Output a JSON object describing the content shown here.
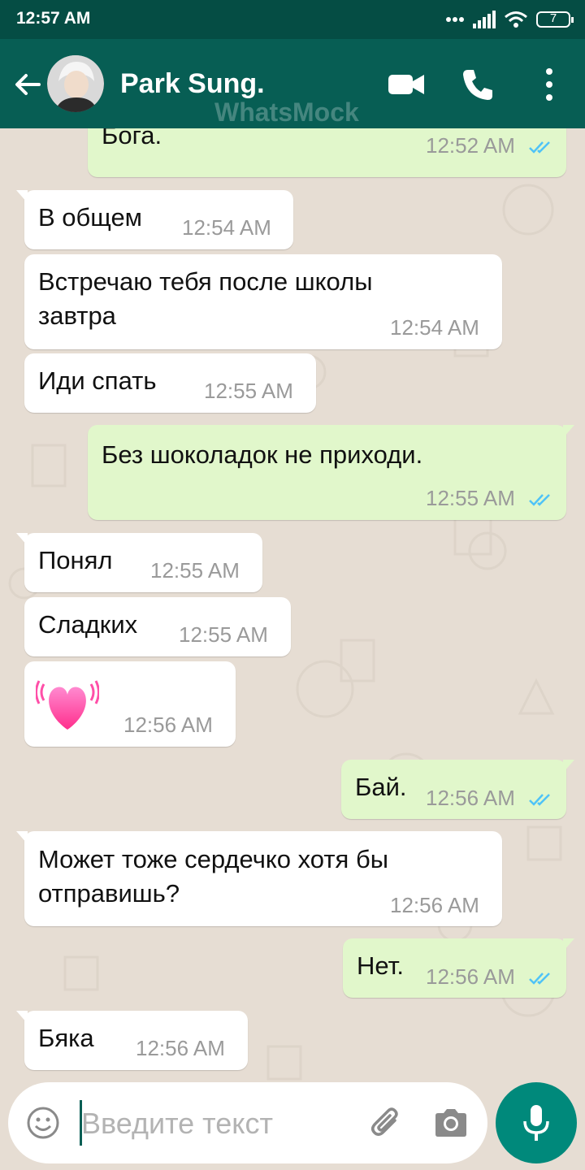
{
  "status_bar": {
    "time": "12:57 AM",
    "battery": "7"
  },
  "header": {
    "contact_name": "Park Sung.",
    "watermark": "WhatsMock"
  },
  "messages": [
    {
      "dir": "out",
      "text": "Бога.",
      "time": "12:52 AM"
    },
    {
      "dir": "in",
      "text": "В общем",
      "time": "12:54 AM"
    },
    {
      "dir": "in",
      "line1": "Встречаю тебя после школы",
      "line2": "завтра",
      "time": "12:54 AM"
    },
    {
      "dir": "in",
      "text": "Иди спать",
      "time": "12:55 AM"
    },
    {
      "dir": "out",
      "text": "Без шоколадок не приходи.",
      "time": "12:55 AM"
    },
    {
      "dir": "in",
      "text": "Понял",
      "time": "12:55 AM"
    },
    {
      "dir": "in",
      "text": "Сладких",
      "time": "12:55 AM"
    },
    {
      "dir": "in",
      "emoji": "heart",
      "time": "12:56 AM"
    },
    {
      "dir": "out",
      "text": "Бай.",
      "time": "12:56 AM"
    },
    {
      "dir": "in",
      "line1": "Может тоже сердечко хотя бы",
      "line2": "отправишь?",
      "time": "12:56 AM"
    },
    {
      "dir": "out",
      "text": "Нет.",
      "time": "12:56 AM"
    },
    {
      "dir": "in",
      "text": "Бяка",
      "time": "12:56 AM"
    }
  ],
  "composer": {
    "placeholder": "Введите текст"
  },
  "colors": {
    "header": "#075e54",
    "status_bar": "#054d44",
    "outgoing_bubble": "#e1f7cb",
    "read_ticks": "#4fc3f7",
    "mic_button": "#00897b"
  }
}
